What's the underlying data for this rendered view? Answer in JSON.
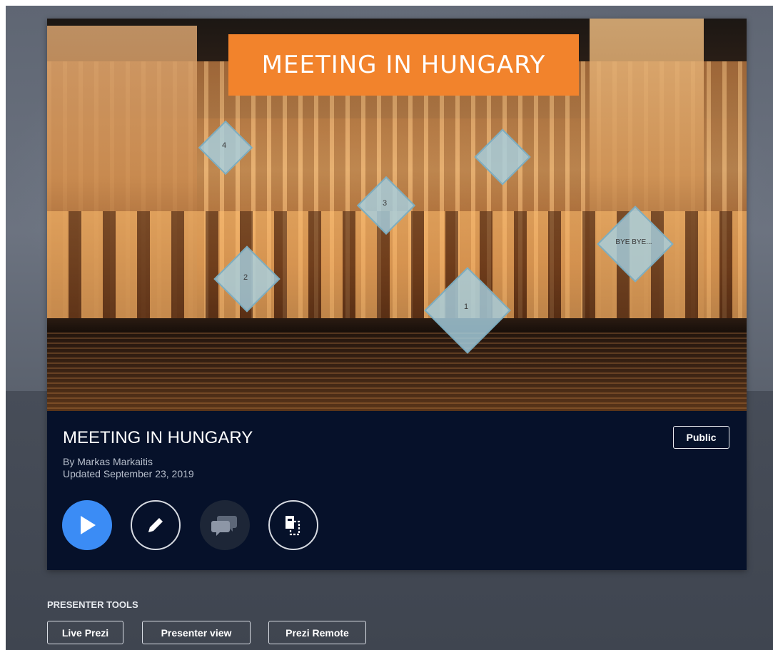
{
  "presentation": {
    "cover_title": "MEETING IN HUNGARY",
    "title": "MEETING IN HUNGARY",
    "author": "By Markas Markaitis",
    "updated": "Updated September 23, 2019",
    "visibility": "Public"
  },
  "topics": [
    {
      "label": "1"
    },
    {
      "label": "2"
    },
    {
      "label": "3"
    },
    {
      "label": "4"
    },
    {
      "label": ""
    },
    {
      "label": "BYE BYE..."
    }
  ],
  "actions": {
    "present": "play-icon",
    "edit": "pencil-icon",
    "comments": "comments-icon",
    "duplicate": "copy-icon"
  },
  "presenter_tools": {
    "heading": "PRESENTER TOOLS",
    "buttons": [
      "Live Prezi",
      "Presenter view",
      "Prezi Remote"
    ]
  },
  "colors": {
    "accent": "#3b8cf5",
    "banner": "#f2832c",
    "card": "#06112a"
  }
}
